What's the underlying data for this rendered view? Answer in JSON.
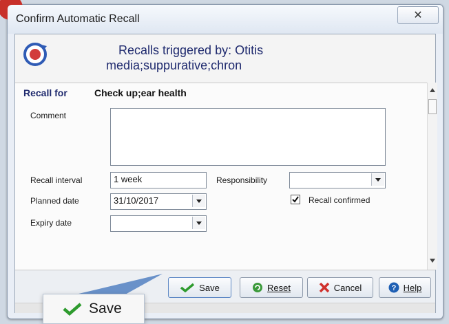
{
  "window": {
    "title": "Confirm Automatic Recall",
    "close_glyph": "✕"
  },
  "header": {
    "line1": "Recalls triggered by: Otitis",
    "line2": "media;suppurative;chron"
  },
  "recall_for": {
    "label": "Recall for",
    "value": "Check up;ear health"
  },
  "form": {
    "comment_label": "Comment",
    "comment_value": "",
    "recall_interval_label": "Recall interval",
    "recall_interval_value": "1 week",
    "responsibility_label": "Responsibility",
    "responsibility_value": "",
    "planned_date_label": "Planned date",
    "planned_date_value": "31/10/2017",
    "expiry_date_label": "Expiry date",
    "expiry_date_value": "",
    "recall_confirmed_label": "Recall confirmed",
    "recall_confirmed_checked": true
  },
  "buttons": {
    "save": "Save",
    "reset": "Reset",
    "cancel": "Cancel",
    "help": "Help"
  },
  "callout": {
    "label": "Save"
  },
  "colors": {
    "header_text": "#1f2a6e",
    "check_green": "#2e9b2e",
    "cancel_red": "#d0312d",
    "help_blue": "#1e5fb4"
  }
}
